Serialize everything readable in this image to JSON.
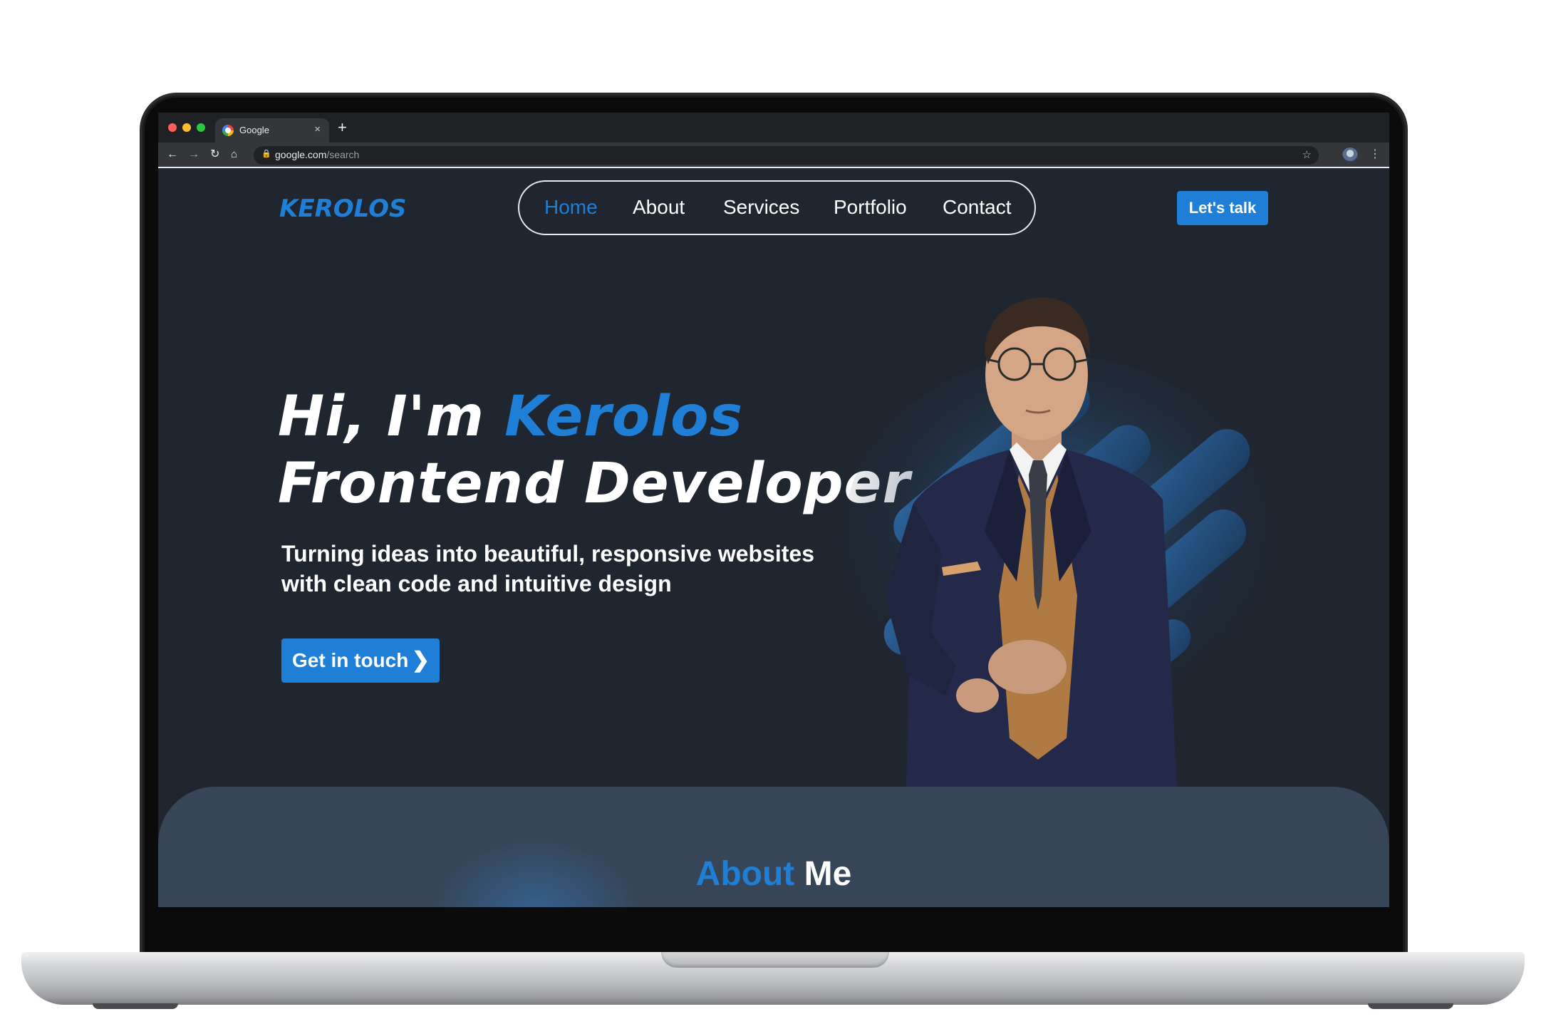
{
  "browser": {
    "tab_title": "Google",
    "tab_close": "×",
    "new_tab": "+",
    "url_host": "google.com",
    "url_path": "/search"
  },
  "site": {
    "logo": "KEROLOS",
    "nav": {
      "home": "Home",
      "about": "About",
      "services": "Services",
      "portfolio": "Portfolio",
      "contact": "Contact"
    },
    "cta_talk": "Let's talk",
    "hero": {
      "greeting": "Hi, I'm",
      "name": "Kerolos",
      "role": "Frontend Developer",
      "subtitle_line1": "Turning ideas into beautiful, responsive websites",
      "subtitle_line2": "with clean code and intuitive design",
      "cta_touch": "Get in touch"
    },
    "about": {
      "title_accent": "About",
      "title_rest": "Me"
    }
  },
  "colors": {
    "accent": "#1f7fd6",
    "page_bg": "#1f2630",
    "about_bg": "#364557"
  },
  "icons": [
    "google-favicon",
    "lock-icon",
    "star-icon",
    "back-arrow-icon",
    "forward-arrow-icon",
    "reload-icon",
    "home-icon",
    "chevron-right-icon",
    "profile-avatar",
    "menu-dots-icon"
  ]
}
